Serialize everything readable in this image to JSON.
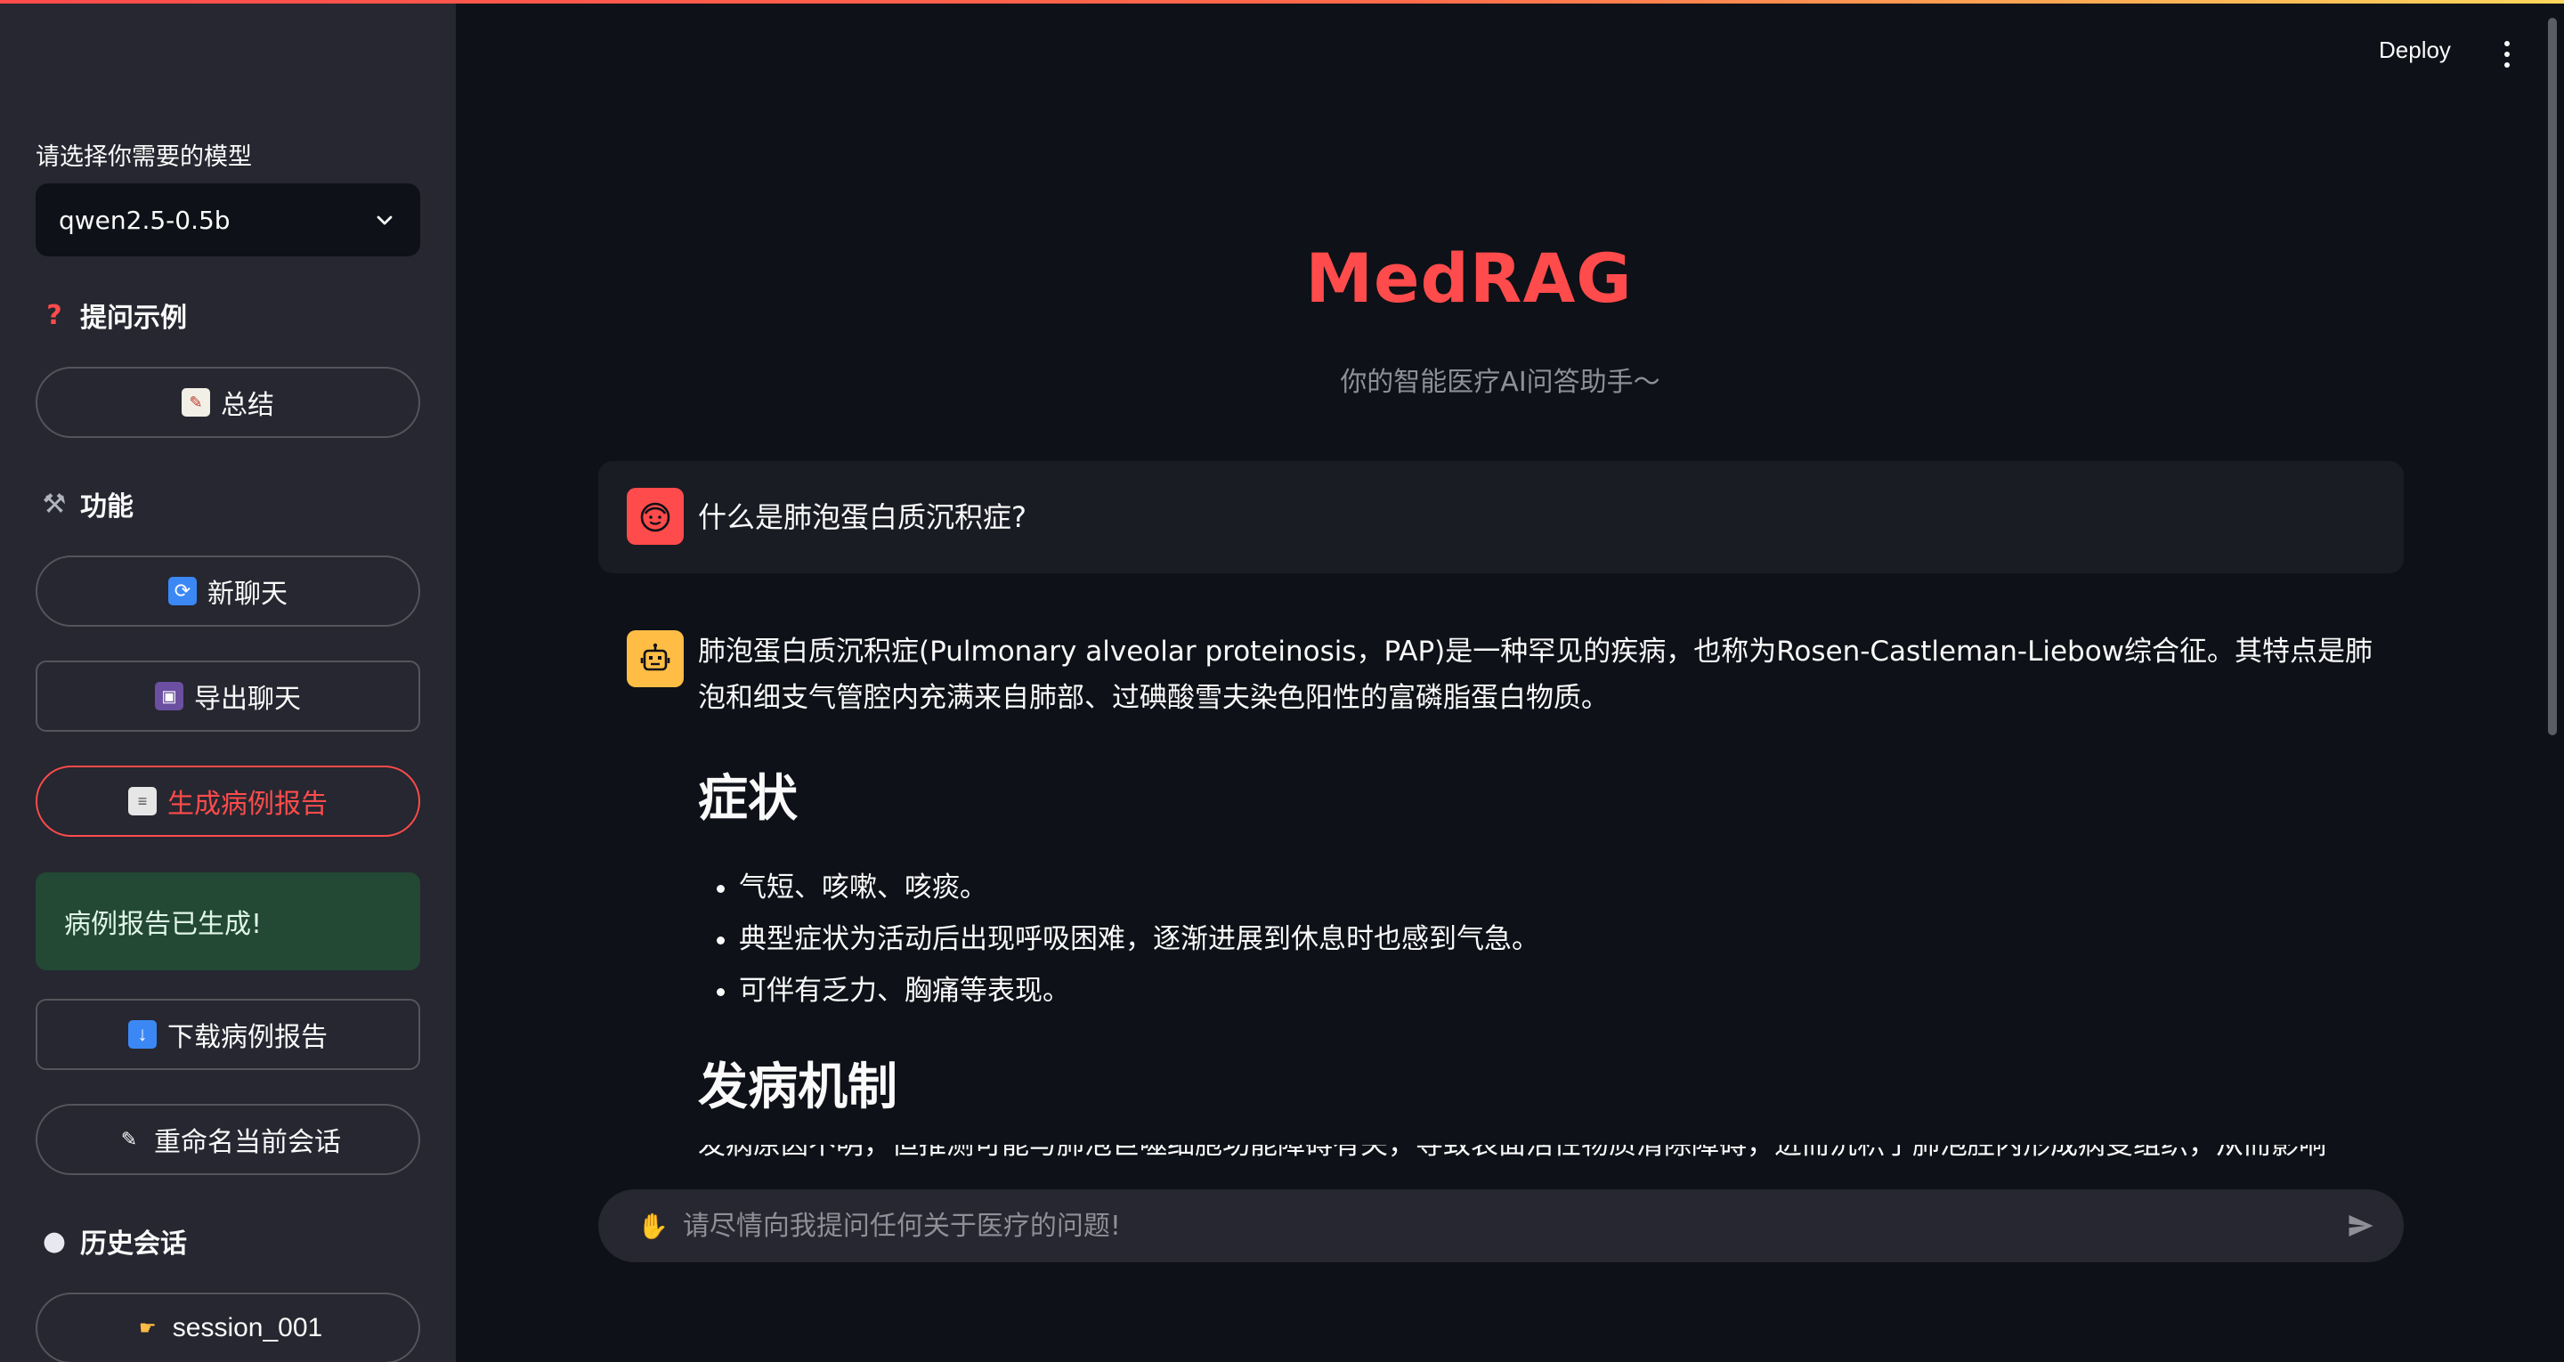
{
  "sidebar": {
    "model_label": "请选择你需要的模型",
    "model_selected": "qwen2.5-0.5b",
    "examples_title": "提问示例",
    "summary_button": "总结",
    "features_title": "功能",
    "new_chat_button": "新聊天",
    "export_chat_button": "导出聊天",
    "generate_report_button": "生成病例报告",
    "success_message": "病例报告已生成!",
    "download_report_button": "下载病例报告",
    "rename_session_button": "重命名当前会话",
    "history_title": "历史会话",
    "history_items": [
      {
        "label": "session_001"
      }
    ]
  },
  "header": {
    "deploy_label": "Deploy"
  },
  "main": {
    "title": "MedRAG",
    "subtitle": "你的智能医疗AI问答助手～",
    "user_message": "什么是肺泡蛋白质沉积症?",
    "answer": {
      "intro": "肺泡蛋白质沉积症(Pulmonary alveolar proteinosis，PAP)是一种罕见的疾病，也称为Rosen-Castleman-Liebow综合征。其特点是肺泡和细支气管腔内充满来自肺部、过碘酸雪夫染色阳性的富磷脂蛋白物质。",
      "symptoms_heading": "症状",
      "symptoms": [
        "气短、咳嗽、咳痰。",
        "典型症状为活动后出现呼吸困难，逐渐进展到休息时也感到气急。",
        "可伴有乏力、胸痛等表现。"
      ],
      "mechanism_heading": "发病机制",
      "mechanism_partial": "发病原因不明，但推测可能与肺泡巨噬细胞功能障碍有关，导致表面活性物质清除障碍，进而沉积于肺泡腔内形成病变组织，从而影响"
    }
  },
  "chat_input": {
    "placeholder": "请尽情向我提问任何关于医疗的问题!"
  },
  "colors": {
    "accent": "#ff4b4b",
    "sidebar_bg": "#262730",
    "main_bg": "#0e1117",
    "success_bg": "#234833",
    "bot_avatar": "#ffbd45"
  }
}
